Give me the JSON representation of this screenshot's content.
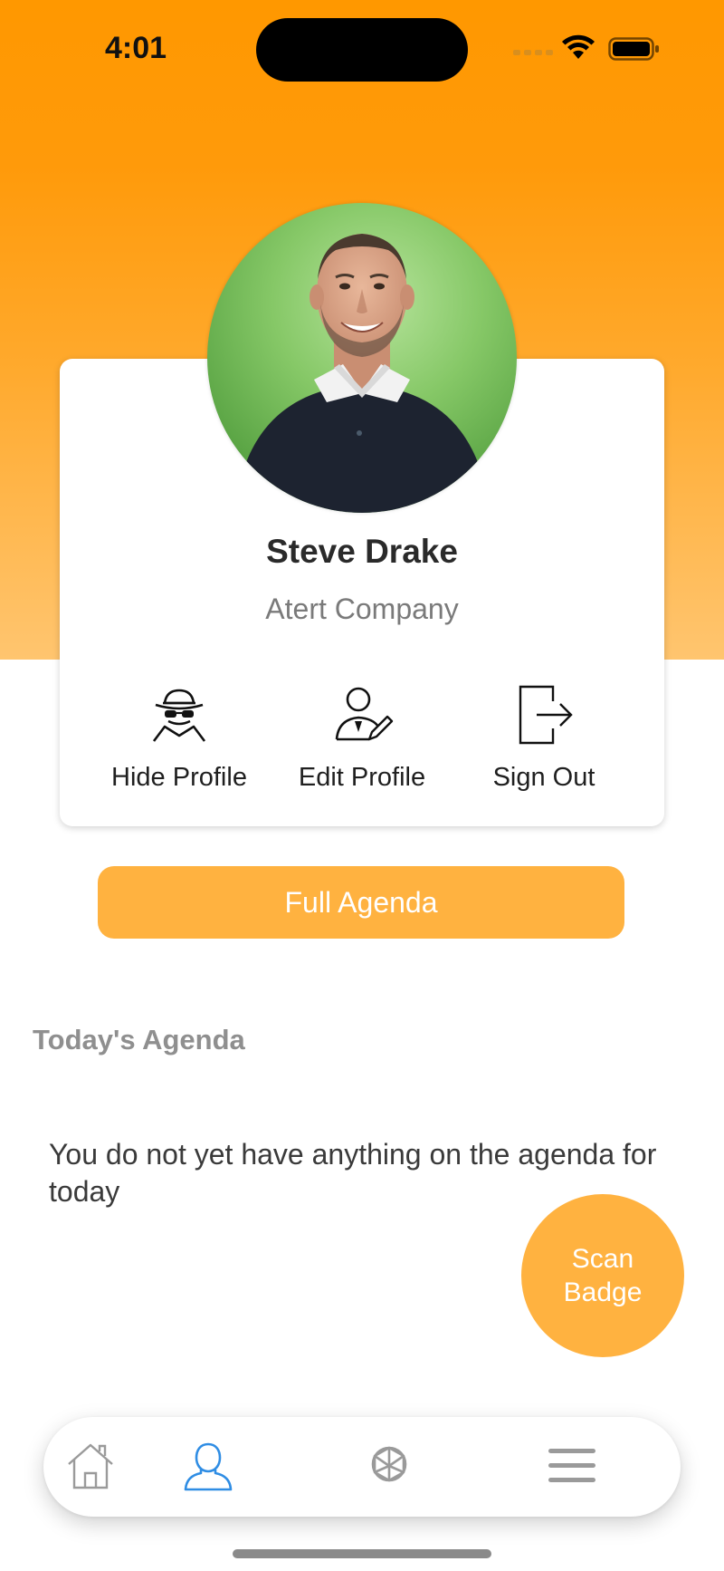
{
  "status_bar": {
    "time": "4:01"
  },
  "profile": {
    "name": "Steve Drake",
    "company": "Atert Company",
    "avatar_icon": "profile-photo"
  },
  "actions": [
    {
      "label": "Hide Profile",
      "icon": "incognito-spy-icon"
    },
    {
      "label": "Edit Profile",
      "icon": "edit-profile-icon"
    },
    {
      "label": "Sign Out",
      "icon": "sign-out-icon"
    }
  ],
  "full_agenda_button": {
    "label": "Full Agenda"
  },
  "todays_agenda": {
    "title": "Today's Agenda",
    "empty_message": "You do not yet have anything on the agenda for today"
  },
  "scan_badge_button": {
    "label": "Scan Badge"
  },
  "tab_bar": {
    "items": [
      {
        "icon": "home-icon",
        "active": false
      },
      {
        "icon": "profile-icon",
        "active": true
      },
      {
        "icon": "ai-chat-icon",
        "active": false
      },
      {
        "icon": "menu-icon",
        "active": false
      }
    ]
  },
  "colors": {
    "header_orange": "#ff9800",
    "accent": "#ffb240",
    "active_tab": "#2f8de4",
    "inactive_tab": "#9a9a9a"
  }
}
